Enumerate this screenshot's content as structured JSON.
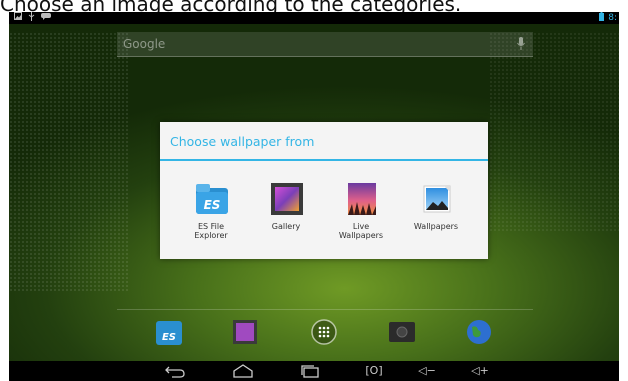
{
  "caption": "Choose an image according to the categories.",
  "status_bar": {
    "time": "8:"
  },
  "search": {
    "label": "Google"
  },
  "dialog": {
    "title": "Choose wallpaper from",
    "options": [
      {
        "label": "ES File\nExplorer",
        "icon": "es-file-explorer-icon"
      },
      {
        "label": "Gallery",
        "icon": "gallery-icon"
      },
      {
        "label": "Live\nWallpapers",
        "icon": "live-wallpapers-icon"
      },
      {
        "label": "Wallpapers",
        "icon": "wallpapers-icon"
      }
    ]
  },
  "dock": {
    "items": [
      "es-file-explorer-icon",
      "gallery-icon",
      "all-apps-icon",
      "camera-icon",
      "browser-icon"
    ]
  },
  "navbar": {
    "buttons": [
      "back-icon",
      "home-icon",
      "recent-apps-icon",
      "screenshot-icon",
      "volume-down-icon",
      "volume-up-icon"
    ],
    "volume_down_label": "◁−",
    "volume_up_label": "◁+",
    "screenshot_label": "[O]"
  },
  "colors": {
    "accent": "#33b5e5",
    "dialog_bg": "#f4f4f4"
  }
}
